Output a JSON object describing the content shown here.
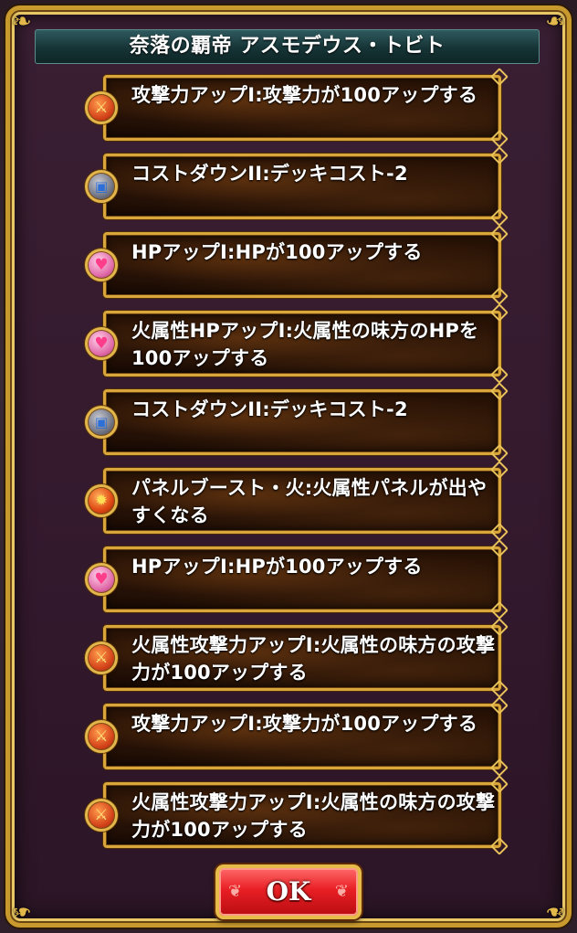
{
  "dialog": {
    "title": "奈落の覇帝 アスモデウス・トビト",
    "ok_label": "OK"
  },
  "skills": [
    {
      "icon": "attack-up-icon",
      "text": "攻撃力アップI:攻撃力が100アップする"
    },
    {
      "icon": "cost-down-icon",
      "text": "コストダウンII:デッキコスト-2"
    },
    {
      "icon": "hp-up-icon",
      "text": "HPアップI:HPが100アップする"
    },
    {
      "icon": "hp-up-icon",
      "text": "火属性HPアップI:火属性の味方のHPを100アップする"
    },
    {
      "icon": "cost-down-icon",
      "text": "コストダウンII:デッキコスト-2"
    },
    {
      "icon": "panel-boost-fire-icon",
      "text": "パネルブースト・火:火属性パネルが出やすくなる"
    },
    {
      "icon": "hp-up-icon",
      "text": "HPアップI:HPが100アップする"
    },
    {
      "icon": "attack-up-icon",
      "text": "火属性攻撃力アップI:火属性の味方の攻撃力が100アップする"
    },
    {
      "icon": "attack-up-icon",
      "text": "攻撃力アップI:攻撃力が100アップする"
    },
    {
      "icon": "attack-up-icon",
      "text": "火属性攻撃力アップI:火属性の味方の攻撃力が100アップする"
    }
  ]
}
